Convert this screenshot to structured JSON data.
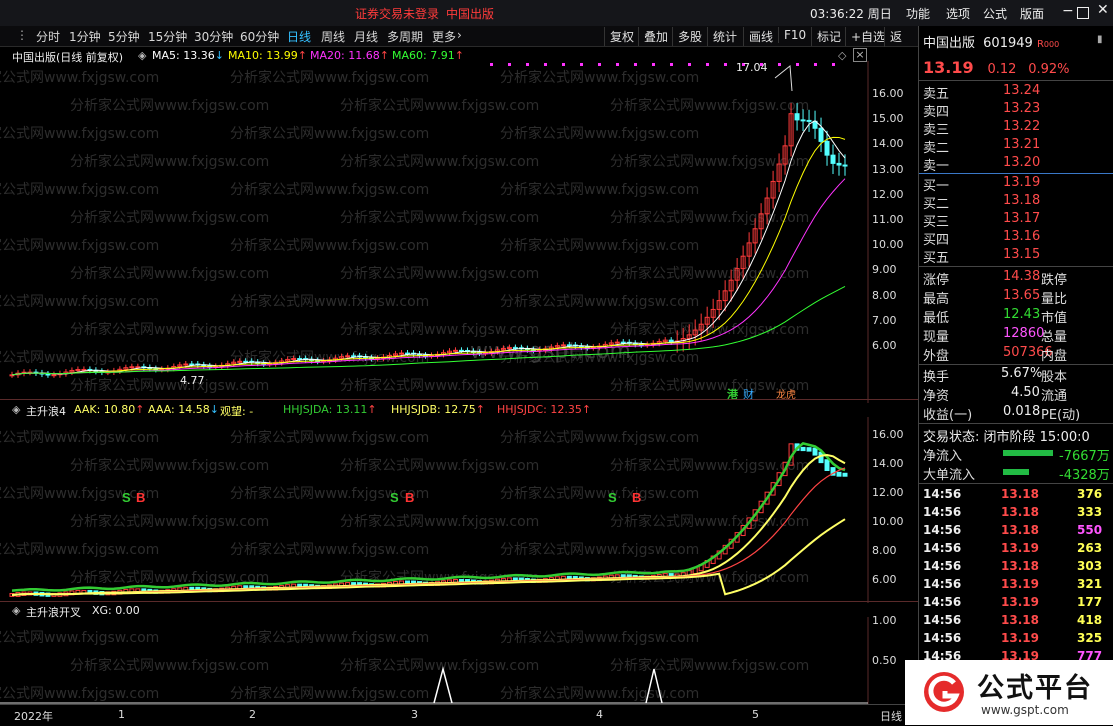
{
  "topbar": {
    "status_text": "证券交易未登录",
    "stock_name": "中国出版",
    "clock": "03:36:22 周日",
    "menu": [
      "功能",
      "选项",
      "公式",
      "版面"
    ],
    "window_btns": [
      "minimize-icon",
      "maximize-icon",
      "close-icon"
    ]
  },
  "toolbar": {
    "periods": [
      "分时",
      "1分钟",
      "5分钟",
      "15分钟",
      "30分钟",
      "60分钟",
      "日线",
      "周线",
      "月线",
      "多周期",
      "更多"
    ],
    "active_period": "日线",
    "right_buttons": [
      "复权",
      "叠加",
      "多股",
      "统计",
      "画线",
      "F10",
      "标记",
      "+自选",
      "返回"
    ]
  },
  "main_chart": {
    "title": "中国出版(日线 前复权)",
    "ma": [
      {
        "label": "MA5: 13.36",
        "arrow": "↓",
        "color": "#ffffff"
      },
      {
        "label": "MA10: 13.99",
        "arrow": "↑",
        "color": "#ffff00"
      },
      {
        "label": "MA20: 11.68",
        "arrow": "↑",
        "color": "#ff33ff"
      },
      {
        "label": "MA60: 7.91",
        "arrow": "↑",
        "color": "#33ff33"
      }
    ],
    "y_ticks": [
      "16.00",
      "15.00",
      "14.00",
      "13.00",
      "12.00",
      "11.00",
      "10.00",
      "9.00",
      "8.00",
      "7.00",
      "6.00"
    ],
    "high_label": "17.04",
    "low_label": "4.77",
    "tags": [
      "港",
      "财",
      "龙虎"
    ]
  },
  "indicator1": {
    "name": "主升浪4",
    "params": [
      {
        "label": "AAK: 10.80",
        "arrow": "↑",
        "color": "#ffff66"
      },
      {
        "label": "AAA: 14.58",
        "arrow": "↓",
        "color": "#ffff66"
      },
      {
        "label": "观望: -",
        "arrow": "",
        "color": "#ffff66"
      },
      {
        "label": "HHJSJDA: 13.11",
        "arrow": "↑",
        "color": "#33cc33"
      },
      {
        "label": "HHJSJDB: 12.75",
        "arrow": "↑",
        "color": "#ffff66"
      },
      {
        "label": "HHJSJDC: 12.35",
        "arrow": "↑",
        "color": "#ff4444"
      }
    ],
    "y_ticks": [
      "16.00",
      "14.00",
      "12.00",
      "10.00",
      "8.00",
      "6.00"
    ],
    "signals": [
      "S",
      "B",
      "S",
      "B",
      "S",
      "B"
    ]
  },
  "indicator2": {
    "name": "主升浪开叉",
    "param": "XG: 0.00",
    "y_ticks": [
      "1.00",
      "0.50"
    ]
  },
  "x_axis": {
    "labels": [
      "2022年",
      "1",
      "2",
      "3",
      "4",
      "5"
    ],
    "period_label": "日线"
  },
  "quote": {
    "name": "中国出版",
    "code": "601949",
    "badge": "R",
    "badge_num": "000",
    "price": "13.19",
    "change": "0.12",
    "pct": "0.92%",
    "asks": [
      {
        "label": "卖五",
        "price": "13.24"
      },
      {
        "label": "卖四",
        "price": "13.23"
      },
      {
        "label": "卖三",
        "price": "13.22"
      },
      {
        "label": "卖二",
        "price": "13.21"
      },
      {
        "label": "卖一",
        "price": "13.20"
      }
    ],
    "bids": [
      {
        "label": "买一",
        "price": "13.19"
      },
      {
        "label": "买二",
        "price": "13.18"
      },
      {
        "label": "买三",
        "price": "13.17"
      },
      {
        "label": "买四",
        "price": "13.16"
      },
      {
        "label": "买五",
        "price": "13.15"
      }
    ],
    "stats": [
      {
        "label": "涨停",
        "value": "14.38",
        "label2": "跌停",
        "color": "#ff4b4b"
      },
      {
        "label": "最高",
        "value": "13.65",
        "label2": "量比",
        "color": "#ff4b4b"
      },
      {
        "label": "最低",
        "value": "12.43",
        "label2": "市值",
        "color": "#33dd33"
      },
      {
        "label": "现量",
        "value": "12860",
        "label2": "总量",
        "color": "#ff55ff"
      },
      {
        "label": "外盘",
        "value": "507366",
        "label2": "内盘",
        "color": "#ff4b4b"
      }
    ],
    "stats2": [
      {
        "label": "换手",
        "value": "5.67%",
        "label2": "股本"
      },
      {
        "label": "净资",
        "value": "4.50",
        "label2": "流通"
      },
      {
        "label": "收益(一)",
        "value": "0.018",
        "label2": "PE(动)"
      }
    ],
    "trade_status": "交易状态: 闭市阶段 15:00:0",
    "flows": [
      {
        "label": "净流入",
        "value": "-7667万"
      },
      {
        "label": "大单流入",
        "value": "-4328万"
      }
    ],
    "ticks": [
      {
        "t": "14:56",
        "p": "13.18",
        "v": "376",
        "vc": "#ffff55"
      },
      {
        "t": "14:56",
        "p": "13.18",
        "v": "333",
        "vc": "#ffff55"
      },
      {
        "t": "14:56",
        "p": "13.18",
        "v": "550",
        "vc": "#ff55ff"
      },
      {
        "t": "14:56",
        "p": "13.19",
        "v": "263",
        "vc": "#ffff55"
      },
      {
        "t": "14:56",
        "p": "13.18",
        "v": "303",
        "vc": "#ffff55"
      },
      {
        "t": "14:56",
        "p": "13.19",
        "v": "321",
        "vc": "#ffff55"
      },
      {
        "t": "14:56",
        "p": "13.19",
        "v": "177",
        "vc": "#ffff55"
      },
      {
        "t": "14:56",
        "p": "13.18",
        "v": "418",
        "vc": "#ffff55"
      },
      {
        "t": "14:56",
        "p": "13.19",
        "v": "325",
        "vc": "#ffff55"
      },
      {
        "t": "14:56",
        "p": "13.19",
        "v": "777",
        "vc": "#ff55ff"
      }
    ]
  },
  "logo": {
    "title": "公式平台",
    "url": "www.gspt.com"
  },
  "watermarks": {
    "site": "分析家公式网www.fxjgsw.com",
    "center": "www.gspt.com"
  }
}
